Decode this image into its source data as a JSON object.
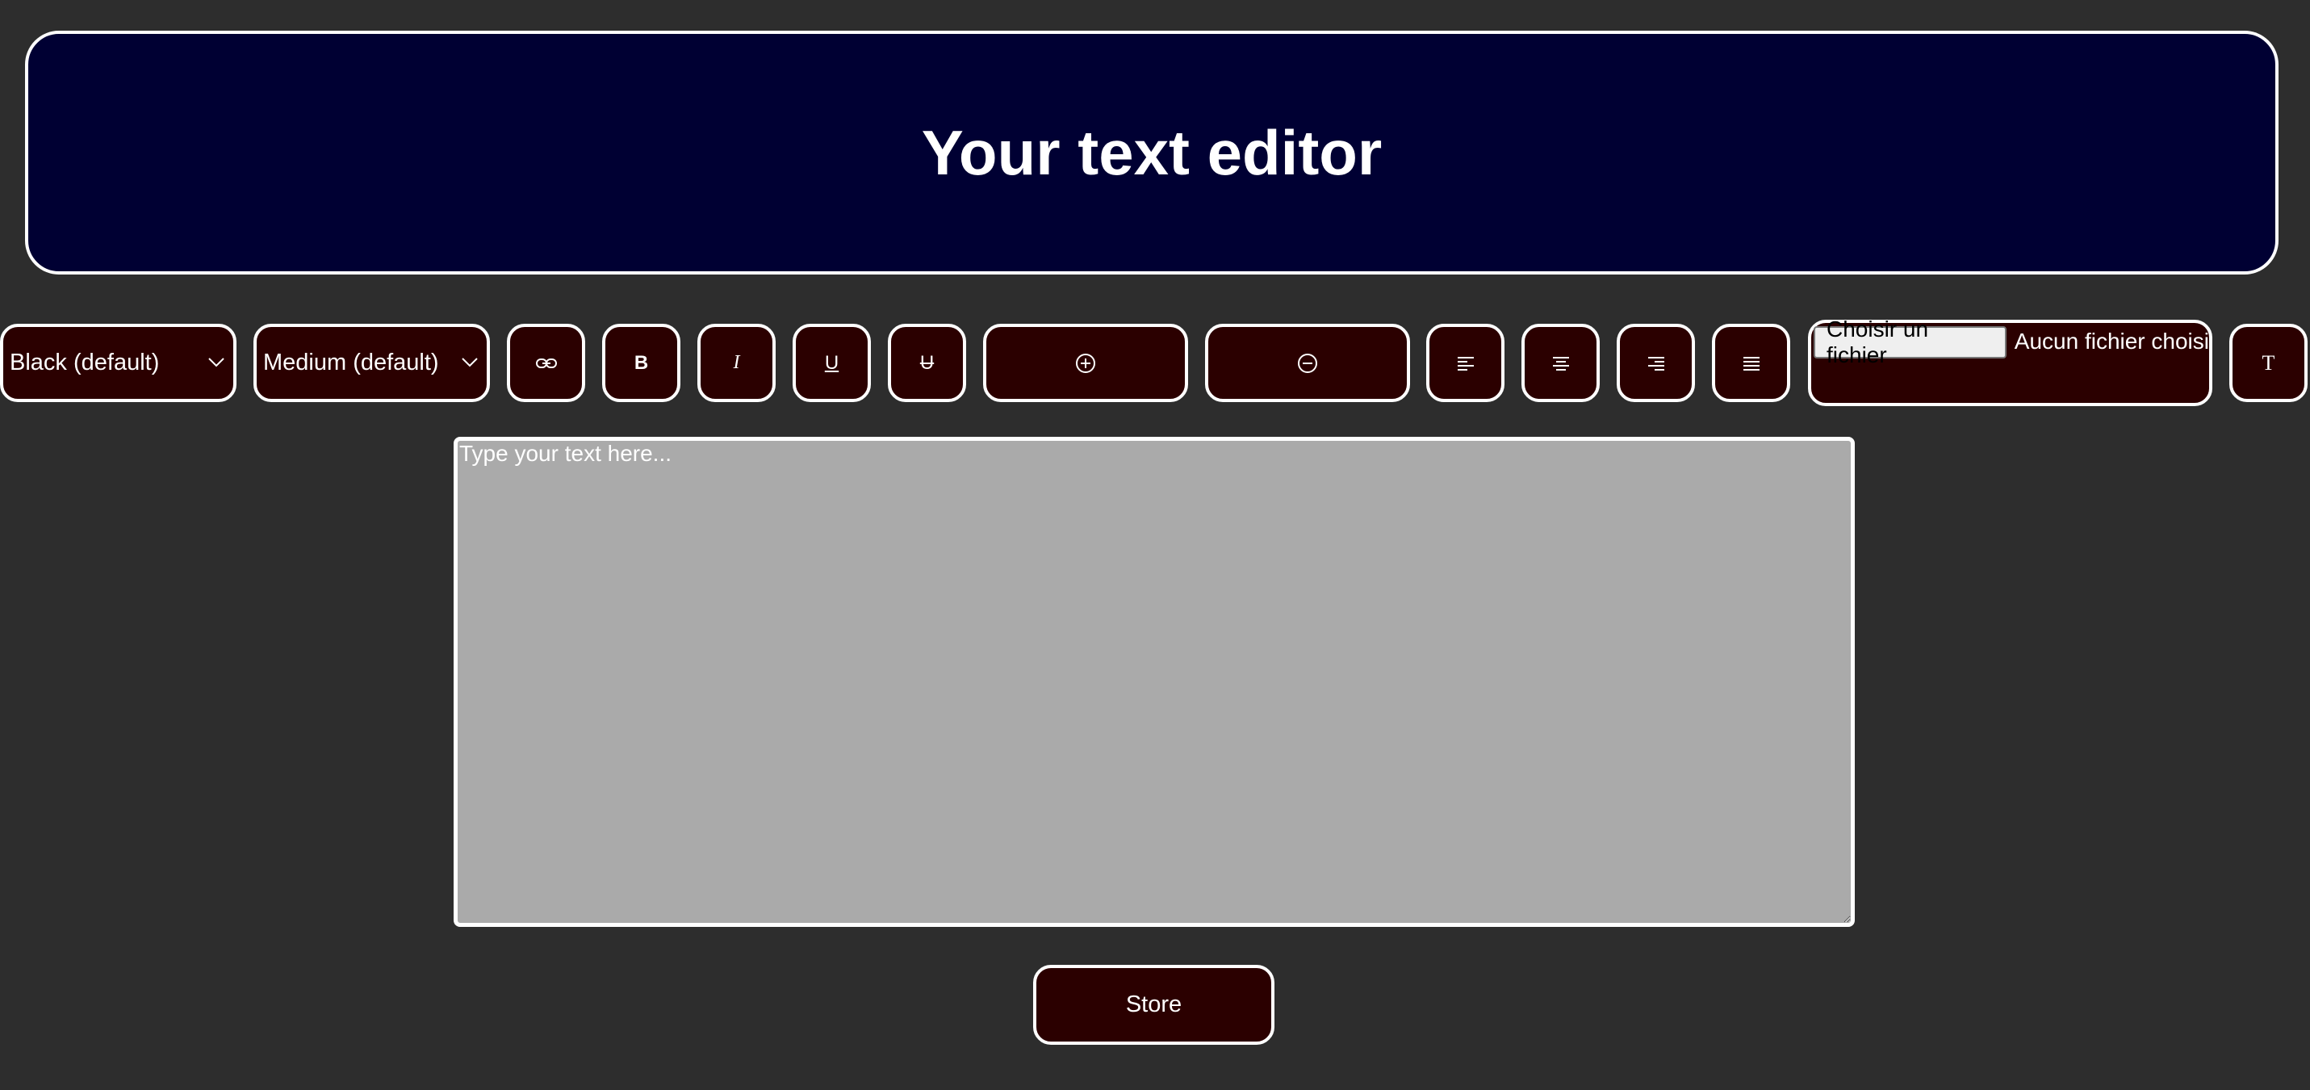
{
  "header": {
    "title": "Your text editor"
  },
  "toolbar": {
    "color_select": {
      "selected": "Black (default)"
    },
    "size_select": {
      "selected": "Medium (default)"
    },
    "link_icon": "link-icon",
    "bold_label": "B",
    "italic_label": "I",
    "underline_label": "U",
    "strike_label": "U",
    "zoom_in_icon": "plus-circle-icon",
    "zoom_out_icon": "minus-circle-icon",
    "align_left_icon": "align-left-icon",
    "align_center_icon": "align-center-icon",
    "align_right_icon": "align-right-icon",
    "justify_icon": "align-justify-icon",
    "file": {
      "button_label": "Choisir un fichier",
      "status": "Aucun fichier choisi"
    },
    "font_label": "T"
  },
  "editor": {
    "placeholder": "Type your text here..."
  },
  "store_label": "Store",
  "colors": {
    "page_bg": "#2d2d2d",
    "header_bg": "#000033",
    "button_bg": "#2b0000",
    "border": "#ffffff",
    "editor_bg": "#aaaaaa"
  }
}
